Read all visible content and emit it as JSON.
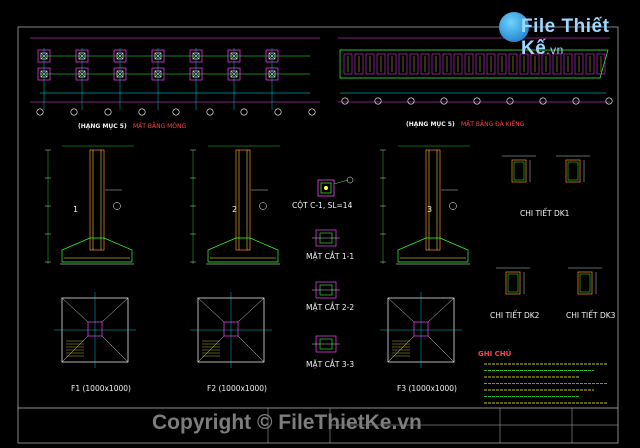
{
  "watermark": {
    "brand": "File Thiết Kế",
    ".suffix": ".vn",
    "suffix": ".vn"
  },
  "plans": {
    "foundation_title": "(HẠNG MỤC 5)",
    "foundation_subtitle": "MẶT BẰNG MÓNG",
    "beam_title": "(HẠNG MỤC 5)",
    "beam_subtitle": "MẶT BẰNG ĐÀ KIỀNG"
  },
  "column": {
    "label": "CỘT C-1, SL=14"
  },
  "sections": [
    {
      "label": "MẶT CẮT 1-1",
      "tag": "1"
    },
    {
      "label": "MẶT CẮT 2-2",
      "tag": "2"
    },
    {
      "label": "MẶT CẮT 3-3",
      "tag": "3"
    }
  ],
  "footings": [
    {
      "label": "F1 (1000x1000)"
    },
    {
      "label": "F2 (1000x1000)"
    },
    {
      "label": "F3 (1000x1000)"
    }
  ],
  "details": [
    {
      "label": "CHI TIẾT DK1"
    },
    {
      "label": "CHI TIẾT DK2"
    },
    {
      "label": "CHI TIẾT DK3"
    }
  ],
  "notes": {
    "title": "GHI CHÚ"
  },
  "copyright": "Copyright © FileThietKe.vn",
  "colors": {
    "accent_cyan": "#00e5ff",
    "accent_yellow": "#ffff40",
    "accent_red": "#ff4040",
    "accent_green": "#33ff33",
    "accent_magenta": "#ff40ff"
  }
}
